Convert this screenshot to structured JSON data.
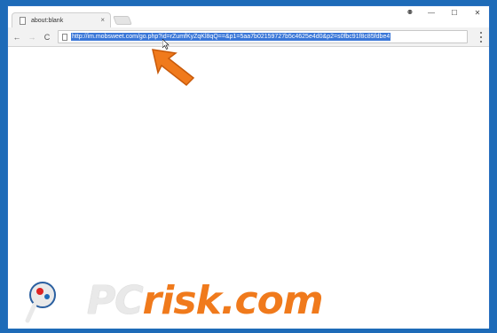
{
  "tab": {
    "title": "about:blank",
    "close_glyph": "×"
  },
  "window_controls": {
    "minimize": "—",
    "maximize": "☐",
    "close": "✕",
    "user_glyph": "⚉"
  },
  "toolbar": {
    "back": "←",
    "forward": "→",
    "reload": "C"
  },
  "omnibox": {
    "url": "http://im.mobsweet.com/go.php?id=rZumfKyZqKl8qQ==&p1=5aa7b02159727b5c4625e4d0&p2=s0fbc91f8c85fdbe4"
  },
  "watermark": {
    "brand": "PC",
    "suffix": "risk.com"
  },
  "colors": {
    "frame": "#1e6bb8",
    "url_highlight": "#3a77d8",
    "arrow": "#f07a1c"
  }
}
